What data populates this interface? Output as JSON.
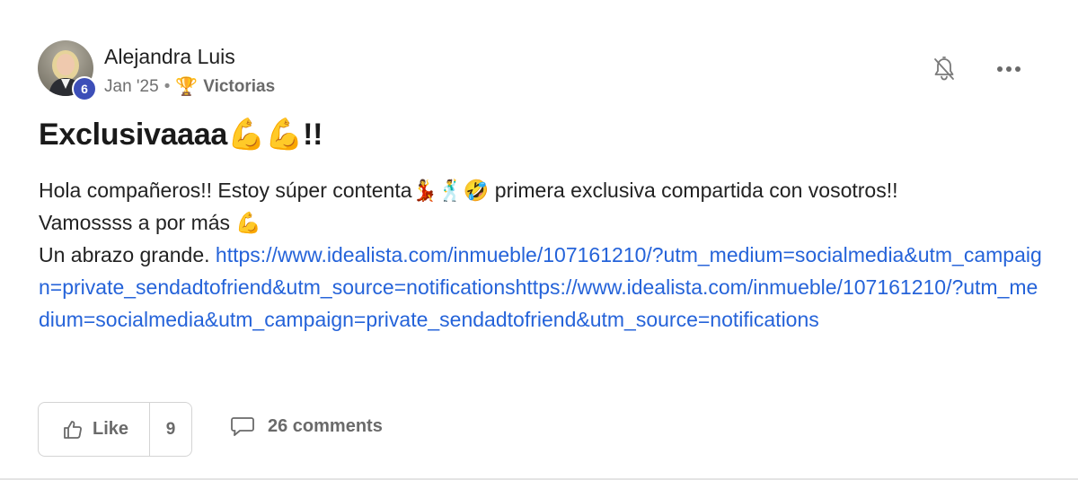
{
  "post": {
    "author": {
      "name": "Alejandra Luis",
      "level": "6",
      "avatar_icon": "avatar-photo"
    },
    "meta": {
      "date": "Jan '25",
      "separator": "•",
      "category_icon": "trophy-icon",
      "category_emoji": "🏆",
      "category": "Victorias"
    },
    "actions": {
      "notifications_icon": "bell-off-icon",
      "more_icon": "more-horizontal-icon"
    },
    "title": "Exclusivaaaa💪💪!!",
    "body": {
      "line1": "Hola compañeros!! Estoy súper contenta💃🕺🤣 primera exclusiva compartida con vosotros!!",
      "line2": "Vamossss a por más 💪",
      "line3_text": "Un abrazo grande. ",
      "link": "https://www.idealista.com/inmueble/107161210/?utm_medium=socialmedia&utm_campaign=private_sendadtofriend&utm_source=notificationshttps://www.idealista.com/inmueble/107161210/?utm_medium=socialmedia&utm_campaign=private_sendadtofriend&utm_source=notifications"
    },
    "footer": {
      "like_label": "Like",
      "like_count": "9",
      "comments_label": "26 comments"
    }
  },
  "colors": {
    "link": "#2563d9",
    "badge": "#3d4fb8",
    "muted_text": "#6a6a6a",
    "border": "#d4d4d4"
  }
}
